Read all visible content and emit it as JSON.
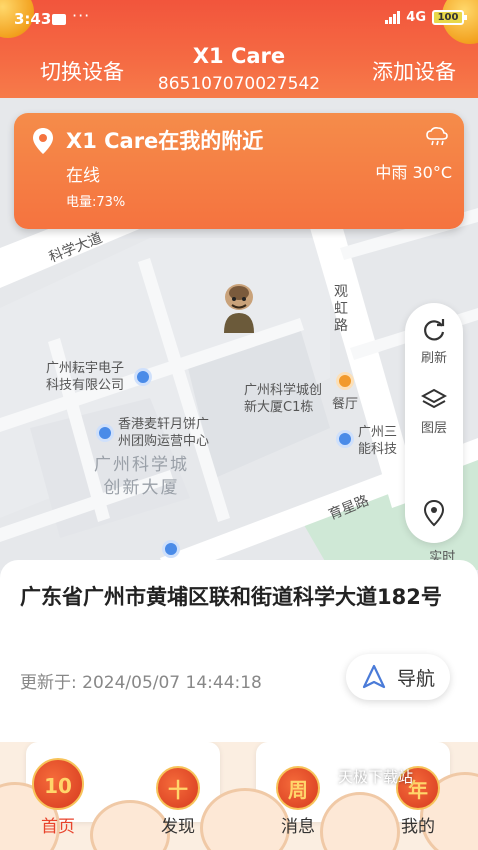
{
  "status_bar": {
    "time": "3:43",
    "dots": "···",
    "network": "4G",
    "battery": "100"
  },
  "header": {
    "switch_device": "切换设备",
    "title": "X1 Care",
    "device_id": "865107070027542",
    "add_device": "添加设备"
  },
  "location_card": {
    "title": "X1 Care在我的附近",
    "status": "在线",
    "battery": "电量:73%",
    "weather": "中雨 30°C",
    "weather_icon": "rain-cloud-icon",
    "pin_icon": "location-pin-icon"
  },
  "map": {
    "labels": {
      "road_kexue": "科学大道",
      "road_guanhong": "观虹路",
      "road_yuxing": "育星路",
      "poi_yunyu": "广州耘宇电子\n科技有限公司",
      "poi_kexuecheng": "广州科学城创\n新大厦C1栋",
      "poi_restaurant": "餐厅",
      "poi_xianggang": "香港麦轩月饼广\n州团购运营中心",
      "poi_sanjin": "广州三\n能科技",
      "area_kexuecheng": "广州科学城\n创新大厦"
    }
  },
  "map_tools": {
    "refresh": "刷新",
    "layers": "图层",
    "realtime": "实时\n定位"
  },
  "address": {
    "full": "广东省广州市黄埔区联和街道科学大道182号",
    "updated_prefix": "更新于:",
    "updated_time": "2024/05/07 14:44:18",
    "navigate": "导航"
  },
  "tabs": [
    {
      "label": "首页",
      "icon_char": "10",
      "active": true
    },
    {
      "label": "发现",
      "icon_char": "十",
      "active": false
    },
    {
      "label": "消息",
      "icon_char": "周",
      "active": false
    },
    {
      "label": "我的",
      "icon_char": "年",
      "active": false
    }
  ],
  "watermark": "天极下载站",
  "colors": {
    "header": "#f2553c",
    "card": "#f5733f",
    "accent": "#e8432c",
    "nav_icon": "#4a7bd8"
  }
}
